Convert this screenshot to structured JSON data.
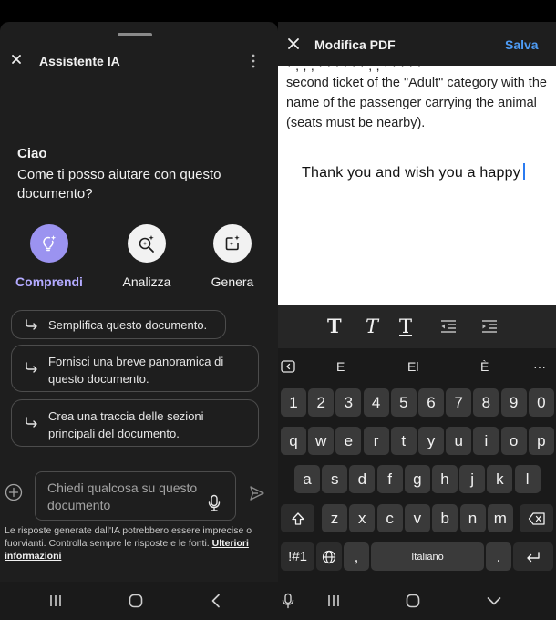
{
  "ai_panel": {
    "title": "Assistente IA",
    "greeting": "Ciao",
    "question": "Come ti posso aiutare con questo documento?",
    "modes": [
      {
        "label": "Comprendi",
        "icon": "lightbulb-sparkle-icon",
        "selected": true
      },
      {
        "label": "Analizza",
        "icon": "magnifier-sparkle-icon",
        "selected": false
      },
      {
        "label": "Genera",
        "icon": "compose-sparkle-icon",
        "selected": false
      }
    ],
    "suggestions": [
      "Semplifica questo documento.",
      "Fornisci una breve panoramica di questo documento.",
      "Crea una traccia delle sezioni principali del documento."
    ],
    "input_placeholder": "Chiedi qualcosa su questo documento",
    "disclaimer": "Le risposte generate dall'IA potrebbero essere imprecise o fuorvianti. Controlla sempre le risposte e le fonti.",
    "disclaimer_link": "Ulteriori informazioni",
    "accent_color": "#9b93f0"
  },
  "editor": {
    "title": "Modifica PDF",
    "save_label": "Salva",
    "doc_cut_line": "· , , , · · · · · · , , · · · · ·",
    "doc_paragraph": "second ticket of the \"Adult\" category with the name of the passenger carrying the animal (seats must be nearby).",
    "edited_text": "Thank you and wish you a happy",
    "format_tools": [
      "bold",
      "italic",
      "underline",
      "outdent",
      "indent"
    ],
    "link_color": "#4e9cf5"
  },
  "keyboard": {
    "suggestions": [
      "E",
      "El",
      "È"
    ],
    "more_label": "···",
    "row_numbers": [
      "1",
      "2",
      "3",
      "4",
      "5",
      "6",
      "7",
      "8",
      "9",
      "0"
    ],
    "row_top": [
      "q",
      "w",
      "e",
      "r",
      "t",
      "y",
      "u",
      "i",
      "o",
      "p"
    ],
    "row_middle": [
      "a",
      "s",
      "d",
      "f",
      "g",
      "h",
      "j",
      "k",
      "l"
    ],
    "row_bottom": [
      "z",
      "x",
      "c",
      "v",
      "b",
      "n",
      "m"
    ],
    "symbols_label": "!#1",
    "comma_label": ",",
    "space_label": "Italiano",
    "period_label": "."
  }
}
